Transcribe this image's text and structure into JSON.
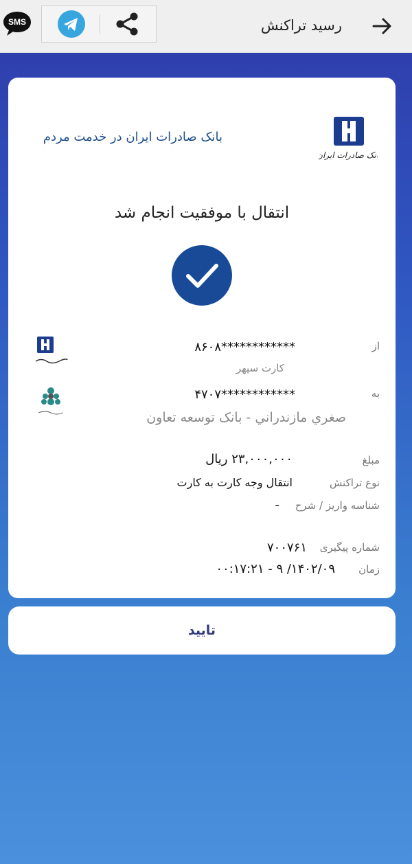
{
  "header": {
    "title": "رسید تراکنش",
    "sms_label": "SMS"
  },
  "receipt": {
    "bank_logo_text": "بانک صادرات ایران",
    "slogan": "بانک صادرات ایران در خدمت مردم",
    "status": "انتقال با موفقیت انجام شد",
    "from_label": "از",
    "from_card": "************۸۶۰۸",
    "from_card_name": "کارت سپهر",
    "to_label": "به",
    "to_card": "************۴۷۰۷",
    "to_name": "صغري مازندراني - بانک توسعه تعاون",
    "amount_label": "مبلغ",
    "amount_value": "۲۳,۰۰۰,۰۰۰ ریال",
    "type_label": "نوع تراکنش",
    "type_value": "انتقال وجه کارت به کارت",
    "deposit_label": "شناسه واریز / شرح",
    "deposit_value": "-",
    "tracking_label": "شماره پیگیری",
    "tracking_value": "۷۰۰۷۶۱",
    "time_label": "زمان",
    "time_value": "۱۴۰۲/۰۹/ ۹ - ۰۰:۱۷:۲۱"
  },
  "actions": {
    "confirm_label": "تایید"
  },
  "colors": {
    "brand_navy": "#1b3c8f",
    "slogan": "#1d4f8a",
    "bg_top": "#2f3aa8",
    "bg_bottom": "#4a90dc",
    "tg_blue": "#37a6de"
  }
}
